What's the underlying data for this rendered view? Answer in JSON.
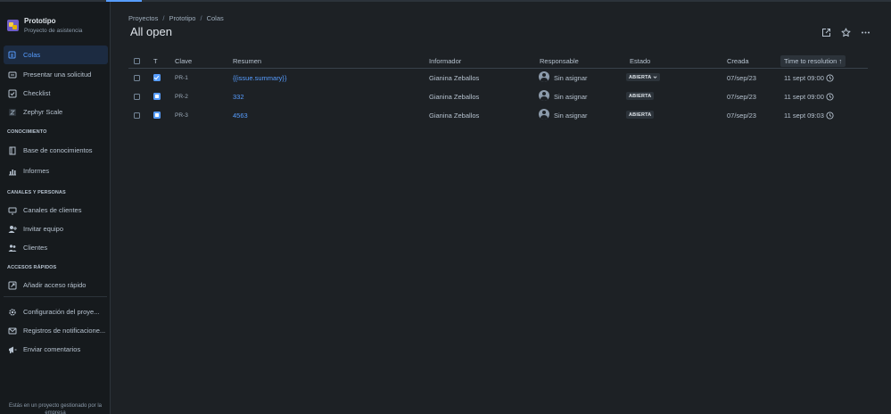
{
  "project": {
    "name": "Prototipo",
    "type": "Proyecto de asistencia"
  },
  "sidebar": {
    "items": [
      {
        "label": "Colas",
        "icon": "queue-icon"
      },
      {
        "label": "Presentar una solicitud",
        "icon": "raise-request-icon"
      },
      {
        "label": "Checklist",
        "icon": "checklist-icon"
      },
      {
        "label": "Zephyr Scale",
        "icon": "zephyr-icon"
      }
    ],
    "sections": {
      "knowledge": {
        "title": "CONOCIMIENTO",
        "items": [
          {
            "label": "Base de conocimientos",
            "icon": "book-icon"
          },
          {
            "label": "Informes",
            "icon": "chart-icon"
          }
        ]
      },
      "channels": {
        "title": "CANALES Y PERSONAS",
        "items": [
          {
            "label": "Canales de clientes",
            "icon": "monitor-icon"
          },
          {
            "label": "Invitar equipo",
            "icon": "invite-icon"
          },
          {
            "label": "Clientes",
            "icon": "people-icon"
          }
        ]
      },
      "shortcuts": {
        "title": "ACCESOS RÁPIDOS",
        "items": [
          {
            "label": "Añadir acceso rápido",
            "icon": "add-shortcut-icon"
          }
        ]
      }
    },
    "bottom_items": [
      {
        "label": "Configuración del proye...",
        "icon": "gear-icon"
      },
      {
        "label": "Registros de notificacione...",
        "icon": "mail-icon"
      },
      {
        "label": "Enviar comentarios",
        "icon": "megaphone-icon"
      }
    ],
    "footer": "Estás en un proyecto gestionado por la empresa"
  },
  "breadcrumb": [
    "Proyectos",
    "Prototipo",
    "Colas"
  ],
  "page_title": "All open",
  "table": {
    "headers": {
      "type": "T",
      "key": "Clave",
      "summary": "Resumen",
      "reporter": "Informador",
      "assignee": "Responsable",
      "status": "Estado",
      "created": "Creada",
      "resolution": "Time to resolution"
    },
    "sort_arrow": "↑",
    "rows": [
      {
        "type": "task",
        "key": "PR-1",
        "summary": "{{issue.summary}}",
        "reporter": "Gianina Zeballos",
        "assignee": "Sin asignar",
        "status": "ABIERTA",
        "has_dropdown": true,
        "created": "07/sep/23",
        "resolution": "11 sept 09:00"
      },
      {
        "type": "request",
        "key": "PR-2",
        "summary": "332",
        "reporter": "Gianina Zeballos",
        "assignee": "Sin asignar",
        "status": "ABIERTA",
        "has_dropdown": false,
        "created": "07/sep/23",
        "resolution": "11 sept 09:00"
      },
      {
        "type": "request",
        "key": "PR-3",
        "summary": "4563",
        "reporter": "Gianina Zeballos",
        "assignee": "Sin asignar",
        "status": "ABIERTA",
        "has_dropdown": false,
        "created": "07/sep/23",
        "resolution": "11 sept 09:03"
      }
    ]
  }
}
